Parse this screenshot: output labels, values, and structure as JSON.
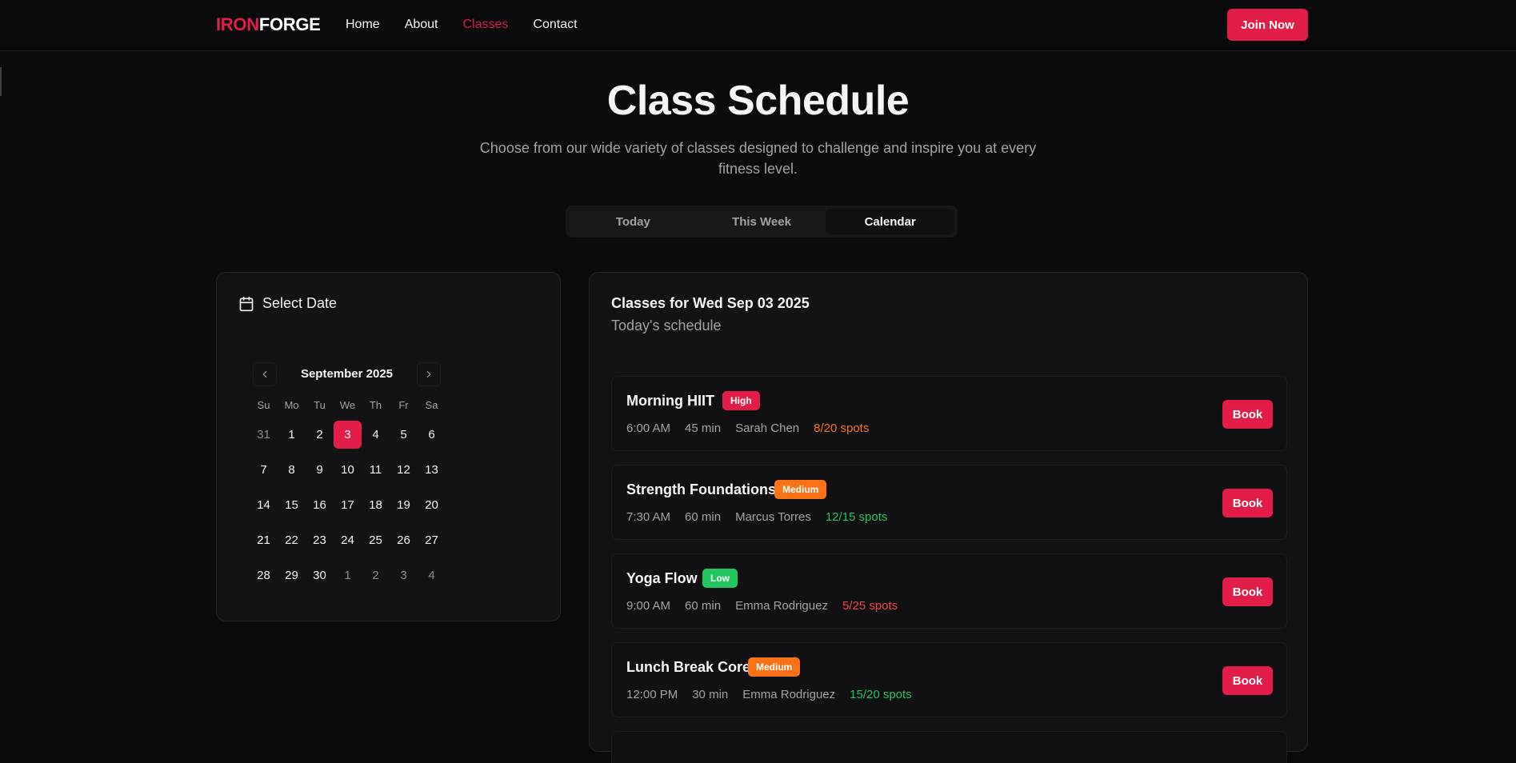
{
  "brand": {
    "part1": "IRON",
    "part2": "FORGE",
    "accent_color": "#e11d48"
  },
  "nav": {
    "links": [
      {
        "label": "Home",
        "active": false
      },
      {
        "label": "About",
        "active": false
      },
      {
        "label": "Classes",
        "active": true
      },
      {
        "label": "Contact",
        "active": false
      }
    ],
    "cta": "Join Now"
  },
  "hero": {
    "title": "Class Schedule",
    "subtitle": "Choose from our wide variety of classes designed to challenge and inspire you at every fitness level."
  },
  "tabs": [
    {
      "label": "Today",
      "active": false
    },
    {
      "label": "This Week",
      "active": false
    },
    {
      "label": "Calendar",
      "active": true
    }
  ],
  "calendar": {
    "heading": "Select Date",
    "heading_icon": "calendar-icon",
    "month_label": "September 2025",
    "prev_icon": "chevron-left-icon",
    "next_icon": "chevron-right-icon",
    "weekdays": [
      "Su",
      "Mo",
      "Tu",
      "We",
      "Th",
      "Fr",
      "Sa"
    ],
    "days": [
      {
        "label": "31",
        "outside": true
      },
      {
        "label": "1"
      },
      {
        "label": "2"
      },
      {
        "label": "3",
        "selected": true
      },
      {
        "label": "4"
      },
      {
        "label": "5"
      },
      {
        "label": "6"
      },
      {
        "label": "7"
      },
      {
        "label": "8"
      },
      {
        "label": "9"
      },
      {
        "label": "10"
      },
      {
        "label": "11"
      },
      {
        "label": "12"
      },
      {
        "label": "13"
      },
      {
        "label": "14"
      },
      {
        "label": "15"
      },
      {
        "label": "16"
      },
      {
        "label": "17"
      },
      {
        "label": "18"
      },
      {
        "label": "19"
      },
      {
        "label": "20"
      },
      {
        "label": "21"
      },
      {
        "label": "22"
      },
      {
        "label": "23"
      },
      {
        "label": "24"
      },
      {
        "label": "25"
      },
      {
        "label": "26"
      },
      {
        "label": "27"
      },
      {
        "label": "28"
      },
      {
        "label": "29"
      },
      {
        "label": "30"
      },
      {
        "label": "1",
        "outside": true
      },
      {
        "label": "2",
        "outside": true
      },
      {
        "label": "3",
        "outside": true
      },
      {
        "label": "4",
        "outside": true
      }
    ]
  },
  "classes": {
    "title": "Classes for Wed Sep 03 2025",
    "subtitle": "Today's schedule",
    "book_label": "Book",
    "items": [
      {
        "name": "Morning HIIT",
        "intensity": "High",
        "intensity_level": "high",
        "time": "6:00 AM",
        "duration": "45 min",
        "instructor": "Sarah Chen",
        "spots": "8/20 spots",
        "spots_color": "orange"
      },
      {
        "name": "Strength Foundations",
        "intensity": "Medium",
        "intensity_level": "medium",
        "time": "7:30 AM",
        "duration": "60 min",
        "instructor": "Marcus Torres",
        "spots": "12/15 spots",
        "spots_color": "green"
      },
      {
        "name": "Yoga Flow",
        "intensity": "Low",
        "intensity_level": "low",
        "time": "9:00 AM",
        "duration": "60 min",
        "instructor": "Emma Rodriguez",
        "spots": "5/25 spots",
        "spots_color": "red"
      },
      {
        "name": "Lunch Break Core",
        "intensity": "Medium",
        "intensity_level": "medium",
        "time": "12:00 PM",
        "duration": "30 min",
        "instructor": "Emma Rodriguez",
        "spots": "15/20 spots",
        "spots_color": "green"
      }
    ]
  }
}
